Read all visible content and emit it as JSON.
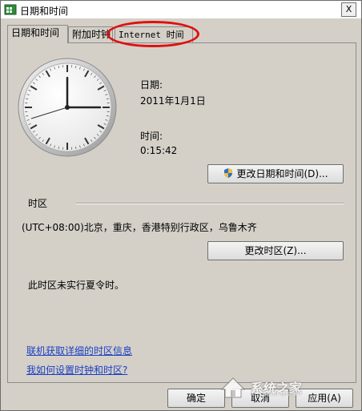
{
  "window": {
    "title": "日期和时间",
    "close_label": "X"
  },
  "tabs": [
    {
      "label": "日期和时间"
    },
    {
      "label": "附加时钟"
    },
    {
      "label": "Internet 时间"
    }
  ],
  "datetime": {
    "date_label": "日期:",
    "date_value": "2011年1月1日",
    "time_label": "时间:",
    "time_value": "0:15:42",
    "change_button": "更改日期和时间(D)..."
  },
  "timezone": {
    "section_label": "时区",
    "value": "(UTC+08:00)北京，重庆，香港特别行政区，乌鲁木齐",
    "change_button": "更改时区(Z)...",
    "dst_note": "此时区未实行夏令时。"
  },
  "links": {
    "online_info": "联机获取详细的时区信息",
    "how_to": "我如何设置时钟和时区?"
  },
  "footer": {
    "ok": "确定",
    "cancel": "取消",
    "apply": "应用(A)"
  },
  "watermark": {
    "text": "系统之家",
    "sub": "XITONGZHIJIA.NET"
  },
  "colors": {
    "link": "#1c3fc4",
    "highlight": "#e01010"
  },
  "icons": {
    "title": "datetime-app-icon",
    "shield": "uac-shield-icon",
    "clock": "analog-clock-icon"
  }
}
